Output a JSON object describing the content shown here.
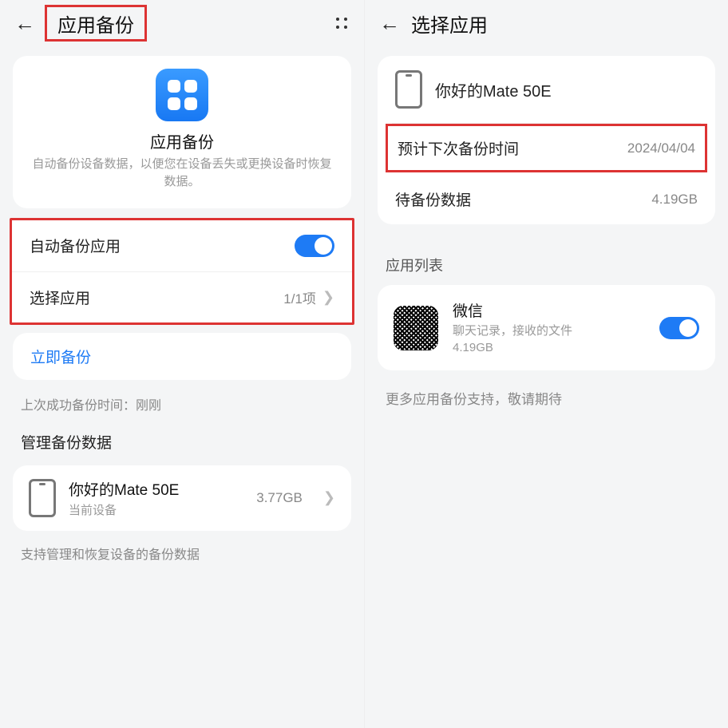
{
  "left": {
    "header_title": "应用备份",
    "hero": {
      "title": "应用备份",
      "desc": "自动备份设备数据，以便您在设备丢失或更换设备时恢复数据。"
    },
    "auto_backup_label": "自动备份应用",
    "select_app_label": "选择应用",
    "select_app_value": "1/1项",
    "backup_now": "立即备份",
    "last_backup": "上次成功备份时间：刚刚",
    "manage_label": "管理备份数据",
    "device": {
      "name": "你好的Mate 50E",
      "sub": "当前设备",
      "size": "3.77GB"
    },
    "support_text": "支持管理和恢复设备的备份数据"
  },
  "right": {
    "header_title": "选择应用",
    "device_name": "你好的Mate 50E",
    "next_backup_label": "预计下次备份时间",
    "next_backup_value": "2024/04/04",
    "pending_label": "待备份数据",
    "pending_value": "4.19GB",
    "app_list_label": "应用列表",
    "app": {
      "name": "微信",
      "sub1": "聊天记录，接收的文件",
      "size": "4.19GB"
    },
    "more_support": "更多应用备份支持，敬请期待"
  }
}
